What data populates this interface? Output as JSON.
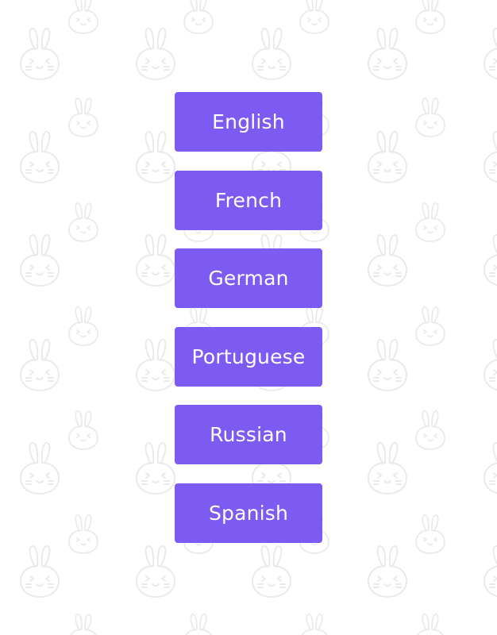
{
  "background": {
    "color": "#ffffff",
    "pattern_icon": "bunny-icon",
    "pattern_color": "#eaeaea"
  },
  "accent_color": "#7d5af1",
  "language_buttons": [
    {
      "label": "English"
    },
    {
      "label": "French"
    },
    {
      "label": "German"
    },
    {
      "label": "Portuguese"
    },
    {
      "label": "Russian"
    },
    {
      "label": "Spanish"
    }
  ]
}
